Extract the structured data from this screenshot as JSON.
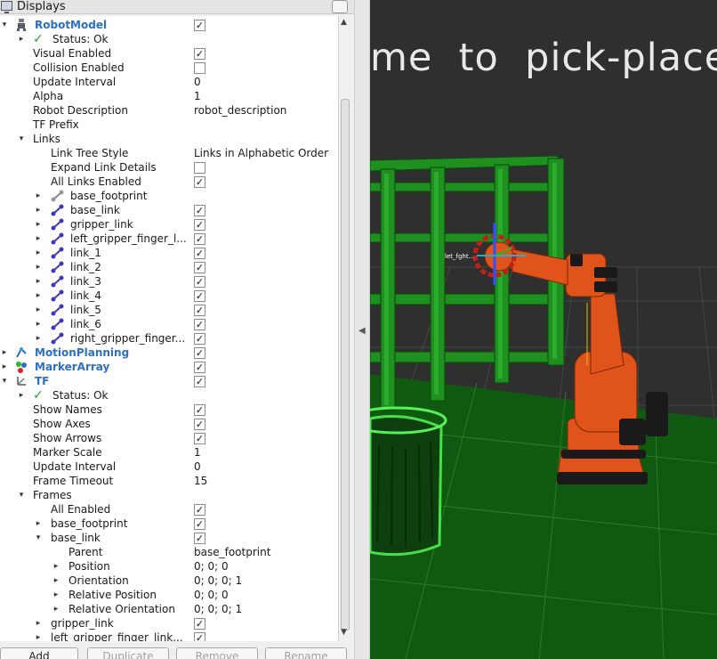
{
  "panel": {
    "title": "Displays"
  },
  "tree": {
    "robot_model": {
      "label": "RobotModel",
      "status": "Status: Ok",
      "visual_enabled": "Visual Enabled",
      "collision_enabled": "Collision Enabled",
      "update_interval": "Update Interval",
      "update_interval_value": "0",
      "alpha": "Alpha",
      "alpha_value": "1",
      "robot_description": "Robot Description",
      "robot_description_value": "robot_description",
      "tf_prefix": "TF Prefix",
      "links": "Links",
      "link_tree_style": "Link Tree Style",
      "link_tree_style_value": "Links in Alphabetic Order",
      "expand_link_details": "Expand Link Details",
      "all_links_enabled": "All Links Enabled",
      "link_items": [
        "base_footprint",
        "base_link",
        "gripper_link",
        "left_gripper_finger_l...",
        "link_1",
        "link_2",
        "link_3",
        "link_4",
        "link_5",
        "link_6",
        "right_gripper_finger..."
      ]
    },
    "motion_planning": "MotionPlanning",
    "marker_array": "MarkerArray",
    "tf": {
      "label": "TF",
      "status": "Status: Ok",
      "show_names": "Show Names",
      "show_axes": "Show Axes",
      "show_arrows": "Show Arrows",
      "marker_scale": "Marker Scale",
      "marker_scale_value": "1",
      "update_interval": "Update Interval",
      "update_interval_value": "0",
      "frame_timeout": "Frame Timeout",
      "frame_timeout_value": "15",
      "frames": "Frames",
      "all_enabled": "All Enabled",
      "base_footprint": "base_footprint",
      "base_link": "base_link",
      "parent": "Parent",
      "parent_value": "base_footprint",
      "position": "Position",
      "position_value": "0; 0; 0",
      "orientation": "Orientation",
      "orientation_value": "0; 0; 0; 1",
      "relative_position": "Relative Position",
      "relative_position_value": "0; 0; 0",
      "relative_orientation": "Relative Orientation",
      "relative_orientation_value": "0; 0; 0; 1",
      "gripper_link": "gripper_link",
      "left_gripper_finger_link": "left_gripper_finger_link..."
    }
  },
  "buttons": {
    "add": "Add",
    "duplicate": "Duplicate",
    "remove": "Remove",
    "rename": "Rename"
  },
  "viewport": {
    "banner": "me  to  pick-place",
    "marker_label": "let_fght..."
  },
  "colors": {
    "display_name_blue": "#2a6fc9",
    "status_ok_green": "#21a021",
    "shelf_green": "#1f8f1f",
    "robot_orange": "#e0531a",
    "floor_green": "#0f5a10"
  },
  "icons": {
    "robot_model": "robot-icon",
    "status": "checkmark-icon",
    "link": "link-icon",
    "motion_planning": "motion-planning-icon",
    "marker_array": "marker-array-icon",
    "tf": "tf-axes-icon"
  }
}
